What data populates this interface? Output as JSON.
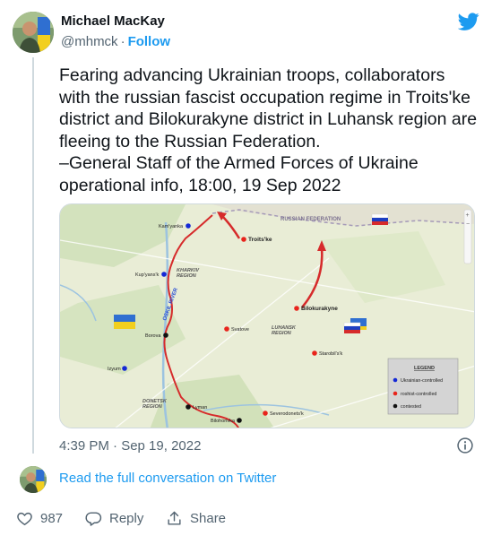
{
  "author": {
    "name": "Michael MacKay",
    "handle": "@mhmck",
    "separator": "·",
    "follow_label": "Follow"
  },
  "tweet": {
    "text": "Fearing advancing Ukrainian troops, collaborators with the russian fascist occupation regime in Troits'ke district and Bilokurakyne district in Luhansk region are fleeing to the Russian Federation.\n–General Staff of the Armed Forces of Ukraine operational info, 18:00, 19 Sep 2022",
    "timestamp": "4:39 PM · Sep 19, 2022"
  },
  "map": {
    "labels": {
      "russian_federation": "RUSSIAN FEDERATION",
      "kharkiv_region": "KHARKIV\nREGION",
      "luhansk_region": "LUHANSK\nREGION",
      "donetsk_region": "DONETSK\nREGION",
      "oskil": "OSKIL RIVER"
    },
    "cities": {
      "kamyanka": "Kam'yanka",
      "troitske": "Troits'ke",
      "kupyansk": "Kup'yans'k",
      "bilokurakyne": "Bilokurakyne",
      "svatove": "Svatove",
      "borova": "Borova",
      "starobilsk": "Starobil's'k",
      "izyum": "Izyum",
      "lyman": "Lyman",
      "sievierodonetsk": "Severodonets'k",
      "bilohorivka": "Bilohorivka"
    },
    "legend": {
      "title": "LEGEND",
      "items": [
        "Ukrainian-controlled",
        "roshist-controlled",
        "contested"
      ]
    },
    "colors": {
      "ukraine_controlled": "#1428d6",
      "russia_controlled": "#e8241c",
      "contested": "#111111",
      "frontline": "#d62b2b"
    }
  },
  "footer": {
    "read_link": "Read the full conversation on Twitter",
    "like_count": "987",
    "reply_label": "Reply",
    "share_label": "Share"
  },
  "colors": {
    "accent": "#1d9bf0",
    "muted": "#536471",
    "text": "#0f1419"
  }
}
